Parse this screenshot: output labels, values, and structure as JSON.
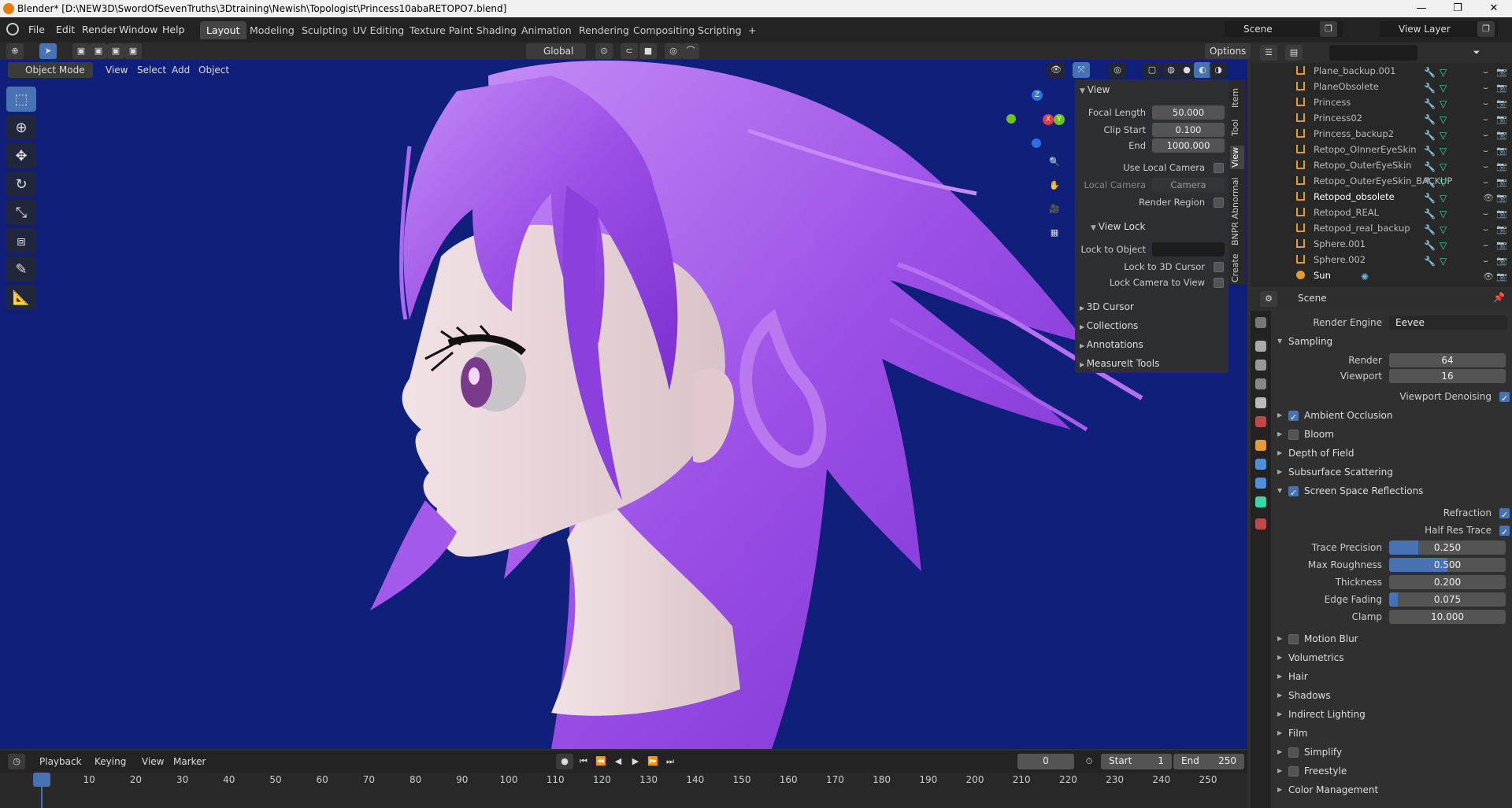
{
  "title_bar": {
    "text": "Blender* [D:\\NEW3D\\SwordOfSevenTruths\\3Dtraining\\Newish\\Topologist\\Princess10abaRETOPO7.blend]",
    "minimize": "—",
    "maximize": "❐",
    "close": "✕"
  },
  "menu": [
    "File",
    "Edit",
    "Render",
    "Window",
    "Help"
  ],
  "workspaces": [
    "Layout",
    "Modeling",
    "Sculpting",
    "UV Editing",
    "Texture Paint",
    "Shading",
    "Animation",
    "Rendering",
    "Compositing",
    "Scripting"
  ],
  "add_workspace": "+",
  "scene": {
    "label": "Scene",
    "view_layer": "View Layer"
  },
  "viewport_toolbar": {
    "orientation": "Global",
    "options": "Options"
  },
  "viewport_header": {
    "mode": "Object Mode",
    "menus": [
      "View",
      "Select",
      "Add",
      "Object"
    ]
  },
  "npanel": {
    "tabs": [
      "Item",
      "Tool",
      "View",
      "BNPR Abnormal",
      "Create"
    ],
    "view_section": "View",
    "focal_length_label": "Focal Length",
    "focal_length": "50.000",
    "clip_start_label": "Clip Start",
    "clip_start": "0.100",
    "end_label": "End",
    "end": "1000.000",
    "use_local_camera": "Use Local Camera",
    "local_camera_label": "Local Camera",
    "local_camera": "Camera",
    "render_region": "Render Region",
    "view_lock": "View Lock",
    "lock_to_object": "Lock to Object",
    "lock_3d_cursor": "Lock to 3D Cursor",
    "lock_camera": "Lock Camera to View",
    "collapsed": [
      "3D Cursor",
      "Collections",
      "Annotations",
      "MeasureIt Tools"
    ]
  },
  "outliner": {
    "rows": [
      {
        "name": "Plane_backup.001"
      },
      {
        "name": "PlaneObsolete"
      },
      {
        "name": "Princess"
      },
      {
        "name": "Princess02"
      },
      {
        "name": "Princess_backup2"
      },
      {
        "name": "Retopo_OInnerEyeSkin"
      },
      {
        "name": "Retopo_OuterEyeSkin"
      },
      {
        "name": "Retopo_OuterEyeSkin_BACKUP"
      },
      {
        "name": "Retopod_obsolete"
      },
      {
        "name": "Retopod_REAL"
      },
      {
        "name": "Retopod_real_backup"
      },
      {
        "name": "Sphere.001"
      },
      {
        "name": "Sphere.002"
      },
      {
        "name": "Sun"
      }
    ]
  },
  "properties": {
    "context": "Scene",
    "render_engine_label": "Render Engine",
    "render_engine": "Eevee",
    "sampling": "Sampling",
    "render_label": "Render",
    "render": "64",
    "viewport_label": "Viewport",
    "viewport": "16",
    "viewport_denoising": "Viewport Denoising",
    "ambient_occlusion": "Ambient Occlusion",
    "bloom": "Bloom",
    "depth_of_field": "Depth of Field",
    "subsurface": "Subsurface Scattering",
    "ssr": "Screen Space Reflections",
    "refraction": "Refraction",
    "half_res": "Half Res Trace",
    "trace_precision_label": "Trace Precision",
    "trace_precision": "0.250",
    "trace_precision_fill": 0.25,
    "max_roughness_label": "Max Roughness",
    "max_roughness": "0.500",
    "max_roughness_fill": 0.5,
    "thickness_label": "Thickness",
    "thickness": "0.200",
    "edge_fading_label": "Edge Fading",
    "edge_fading": "0.075",
    "edge_fading_fill": 0.075,
    "clamp_label": "Clamp",
    "clamp": "10.000",
    "motion_blur": "Motion Blur",
    "volumetrics": "Volumetrics",
    "hair": "Hair",
    "shadows": "Shadows",
    "indirect_lighting": "Indirect Lighting",
    "film": "Film",
    "simplify": "Simplify",
    "freestyle": "Freestyle",
    "color_management": "Color Management"
  },
  "timeline": {
    "menus": [
      "Playback",
      "Keying",
      "View",
      "Marker"
    ],
    "current_frame": "0",
    "start_label": "Start",
    "start": "1",
    "end_label": "End",
    "end": "250",
    "ticks": [
      "0",
      "10",
      "20",
      "30",
      "40",
      "50",
      "60",
      "70",
      "80",
      "90",
      "100",
      "110",
      "120",
      "130",
      "140",
      "150",
      "160",
      "170",
      "180",
      "190",
      "200",
      "210",
      "220",
      "230",
      "240",
      "250"
    ]
  },
  "colors": {
    "viewport_bg": "#10207a",
    "hair": "#9b4fe6",
    "skin": "#e8d4d8",
    "accent": "#4772b3",
    "object_orange": "#e49b36",
    "mesh_green": "#39d6a8"
  }
}
